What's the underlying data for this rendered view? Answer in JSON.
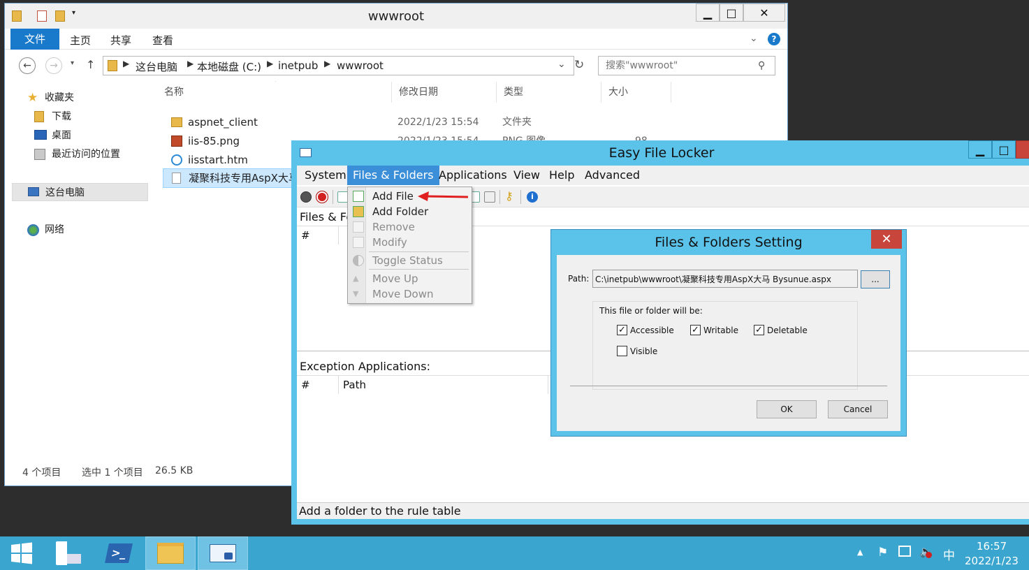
{
  "explorer": {
    "title": "wwwroot",
    "ribbon_tabs": [
      "文件",
      "主页",
      "共享",
      "查看"
    ],
    "address": [
      "这台电脑",
      "本地磁盘 (C:)",
      "inetpub",
      "wwwroot"
    ],
    "search_placeholder": "搜索\"wwwroot\"",
    "sidebar": {
      "favorites": "收藏夹",
      "downloads": "下载",
      "desktop": "桌面",
      "recent": "最近访问的位置",
      "this_pc": "这台电脑",
      "network": "网络"
    },
    "columns": [
      "名称",
      "修改日期",
      "类型",
      "大小"
    ],
    "files": [
      {
        "name": "aspnet_client",
        "date": "2022/1/23 15:54",
        "type": "文件夹",
        "size": ""
      },
      {
        "name": "iis-85.png",
        "date": "2022/1/23 15:54",
        "type": "PNG 图像",
        "size": "98 KB"
      },
      {
        "name": "iisstart.htm",
        "date": "",
        "type": "",
        "size": ""
      },
      {
        "name": "凝聚科技专用AspX大马",
        "date": "",
        "type": "",
        "size": ""
      }
    ],
    "status_count": "4 个项目",
    "status_selected": "选中 1 个项目",
    "status_size": "26.5 KB"
  },
  "efl": {
    "title": "Easy File Locker",
    "menu": [
      "System",
      "Files & Folders",
      "Applications",
      "View",
      "Help",
      "Advanced"
    ],
    "files_label": "Files & Fo",
    "grid_hash": "#",
    "exception_label": "Exception Applications:",
    "exception_cols": [
      "#",
      "Path"
    ],
    "status": "Add a folder to the rule table"
  },
  "dropdown": {
    "items": [
      "Add File",
      "Add Folder",
      "Remove",
      "Modify",
      "Toggle Status",
      "Move Up",
      "Move Down"
    ]
  },
  "dialog": {
    "title": "Files & Folders Setting",
    "path_label": "Path:",
    "path_value": "C:\\inetpub\\wwwroot\\凝聚科技专用AspX大马 Bysunue.aspx",
    "browse_label": "...",
    "group_label": "This file or folder will be:",
    "options": {
      "accessible": "Accessible",
      "writable": "Writable",
      "deletable": "Deletable",
      "visible": "Visible"
    },
    "ok": "OK",
    "cancel": "Cancel"
  },
  "taskbar": {
    "time": "16:57",
    "date": "2022/1/23",
    "ime": "中"
  },
  "colors": {
    "accent": "#1979ca",
    "efl_frame": "#5bc3ea",
    "taskbar": "#3aa6cf",
    "close_red": "#c7453b"
  }
}
